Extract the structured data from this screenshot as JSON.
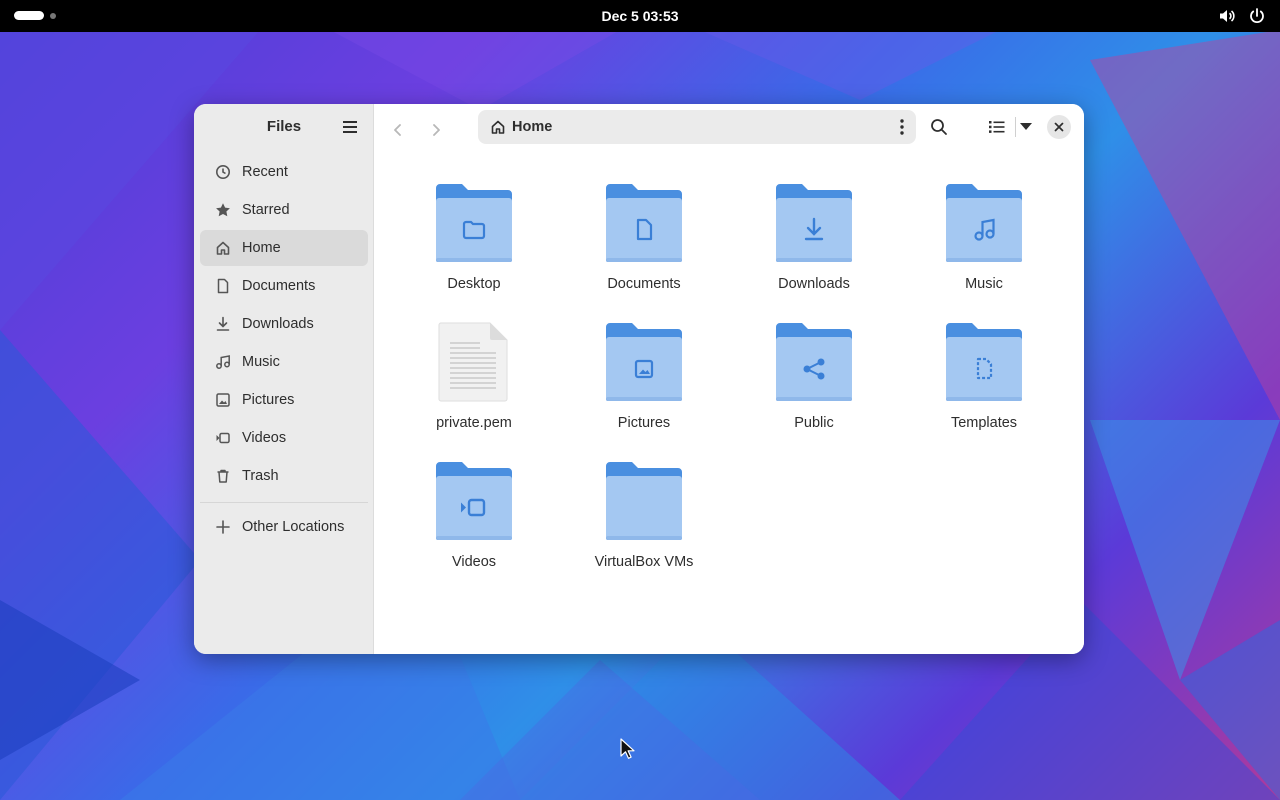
{
  "topbar": {
    "clock": "Dec 5  03:53",
    "icons": [
      "volume-icon",
      "power-icon"
    ]
  },
  "sidebar": {
    "title": "Files",
    "items": [
      {
        "label": "Recent",
        "icon": "clock-icon"
      },
      {
        "label": "Starred",
        "icon": "star-icon"
      },
      {
        "label": "Home",
        "icon": "home-icon",
        "active": true
      },
      {
        "label": "Documents",
        "icon": "document-icon"
      },
      {
        "label": "Downloads",
        "icon": "download-icon"
      },
      {
        "label": "Music",
        "icon": "music-icon"
      },
      {
        "label": "Pictures",
        "icon": "image-icon"
      },
      {
        "label": "Videos",
        "icon": "video-icon"
      },
      {
        "label": "Trash",
        "icon": "trash-icon"
      }
    ],
    "other_locations": "Other Locations"
  },
  "toolbar": {
    "location": "Home"
  },
  "files": [
    {
      "name": "Desktop",
      "kind": "folder",
      "emblem": "folder"
    },
    {
      "name": "Documents",
      "kind": "folder",
      "emblem": "document"
    },
    {
      "name": "Downloads",
      "kind": "folder",
      "emblem": "download"
    },
    {
      "name": "Music",
      "kind": "folder",
      "emblem": "music"
    },
    {
      "name": "private.pem",
      "kind": "text-file"
    },
    {
      "name": "Pictures",
      "kind": "folder",
      "emblem": "image"
    },
    {
      "name": "Public",
      "kind": "folder",
      "emblem": "share"
    },
    {
      "name": "Templates",
      "kind": "folder",
      "emblem": "template"
    },
    {
      "name": "Videos",
      "kind": "folder",
      "emblem": "video"
    },
    {
      "name": "VirtualBox VMs",
      "kind": "folder",
      "emblem": "none"
    }
  ],
  "colors": {
    "folder_back": "#4a8fe0",
    "folder_front": "#a4c8f2",
    "emblem": "#3a7fd6",
    "sidebar_bg": "#ebebeb",
    "topbar_bg": "#000000"
  }
}
